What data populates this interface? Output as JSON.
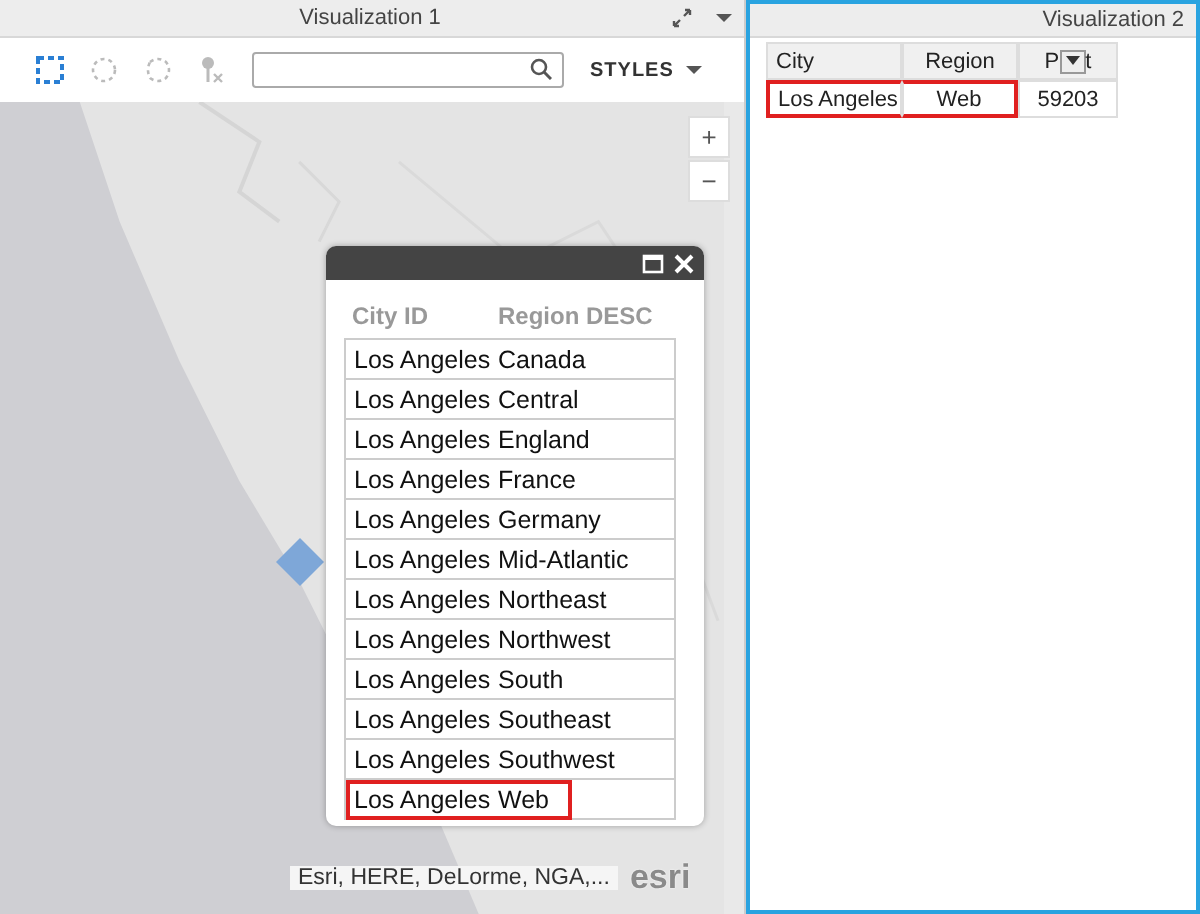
{
  "panels": [
    {
      "title": "Visualization 1"
    },
    {
      "title": "Visualization 2"
    }
  ],
  "toolbar": {
    "styles_button": "STYLES"
  },
  "map": {
    "kind": "picture",
    "zoom_in": "+",
    "zoom_out": "−",
    "attribution": "Esri, HERE, DeLorme, NGA,...",
    "logo": "esri"
  },
  "popup": {
    "columns": [
      "City ID",
      "Region DESC"
    ],
    "rows": [
      {
        "cells": [
          "Los Angeles",
          "Canada"
        ],
        "highlighted": false
      },
      {
        "cells": [
          "Los Angeles",
          "Central"
        ],
        "highlighted": false
      },
      {
        "cells": [
          "Los Angeles",
          "England"
        ],
        "highlighted": false
      },
      {
        "cells": [
          "Los Angeles",
          "France"
        ],
        "highlighted": false
      },
      {
        "cells": [
          "Los Angeles",
          "Germany"
        ],
        "highlighted": false
      },
      {
        "cells": [
          "Los Angeles",
          "Mid-Atlantic"
        ],
        "highlighted": false
      },
      {
        "cells": [
          "Los Angeles",
          "Northeast"
        ],
        "highlighted": false
      },
      {
        "cells": [
          "Los Angeles",
          "Northwest"
        ],
        "highlighted": false
      },
      {
        "cells": [
          "Los Angeles",
          "South"
        ],
        "highlighted": false
      },
      {
        "cells": [
          "Los Angeles",
          "Southeast"
        ],
        "highlighted": false
      },
      {
        "cells": [
          "Los Angeles",
          "Southwest"
        ],
        "highlighted": false
      },
      {
        "cells": [
          "Los Angeles",
          "Web"
        ],
        "highlighted": true
      }
    ]
  },
  "table": {
    "columns": [
      {
        "label": "City"
      },
      {
        "label": "Region"
      },
      {
        "label_start": "P",
        "label_end": "t"
      }
    ],
    "rows": [
      {
        "cells": [
          "Los Angeles",
          "Web",
          "59203"
        ],
        "highlighted": true
      }
    ]
  }
}
